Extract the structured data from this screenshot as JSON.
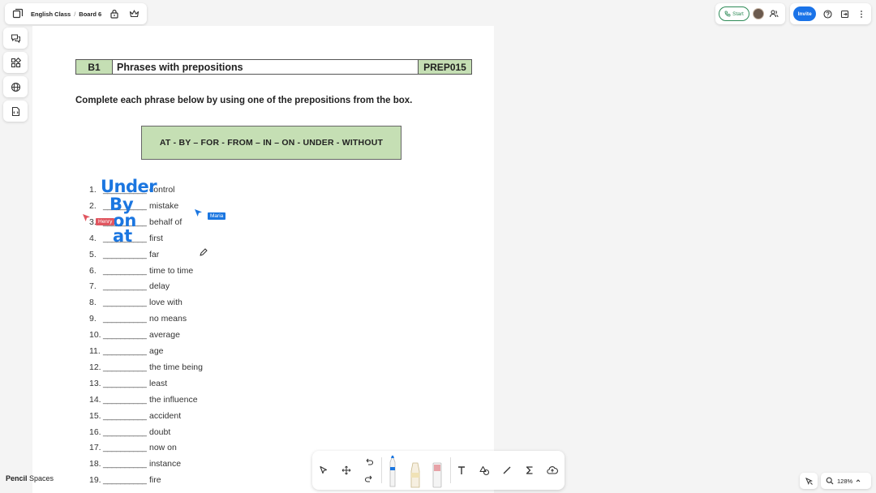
{
  "topbar": {
    "board_path": {
      "class": "English Class",
      "separator": "/",
      "board": "Board 6"
    },
    "start_label": "Start",
    "invite_label": "Invite"
  },
  "worksheet": {
    "level": "B1",
    "title": "Phrases with prepositions",
    "code": "PREP015",
    "instruction": "Complete each phrase below by using one of the prepositions from the box.",
    "prepositions": "AT - BY – FOR - FROM – IN – ON - UNDER - WITHOUT",
    "blank": "__________",
    "items": [
      {
        "num": "1.",
        "phrase": "control"
      },
      {
        "num": "2.",
        "phrase": "mistake"
      },
      {
        "num": "3.",
        "phrase": "behalf of"
      },
      {
        "num": "4.",
        "phrase": "first"
      },
      {
        "num": "5.",
        "phrase": "far"
      },
      {
        "num": "6.",
        "phrase": "time to time"
      },
      {
        "num": "7.",
        "phrase": "delay"
      },
      {
        "num": "8.",
        "phrase": "love with"
      },
      {
        "num": "9.",
        "phrase": "no means"
      },
      {
        "num": "10.",
        "phrase": "average"
      },
      {
        "num": "11.",
        "phrase": "age"
      },
      {
        "num": "12.",
        "phrase": "the time being"
      },
      {
        "num": "13.",
        "phrase": "least"
      },
      {
        "num": "14.",
        "phrase": "the influence"
      },
      {
        "num": "15.",
        "phrase": "accident"
      },
      {
        "num": "16.",
        "phrase": "doubt"
      },
      {
        "num": "17.",
        "phrase": "now on"
      },
      {
        "num": "18.",
        "phrase": "instance"
      },
      {
        "num": "19.",
        "phrase": "fire"
      }
    ]
  },
  "handwriting": [
    "Under",
    "By",
    "on",
    "at"
  ],
  "cursors": [
    {
      "name": "Henry",
      "color": "#e0555f"
    },
    {
      "name": "Maria",
      "color": "#1b76e0"
    }
  ],
  "brand": {
    "strong": "Pencil",
    "rest": " Spaces"
  },
  "zoom": "128%",
  "colors": {
    "accent": "#1a73e8",
    "cell_green": "#c5dfb4",
    "ink_blue": "#1b76e0",
    "start_green": "#2e8b57"
  }
}
